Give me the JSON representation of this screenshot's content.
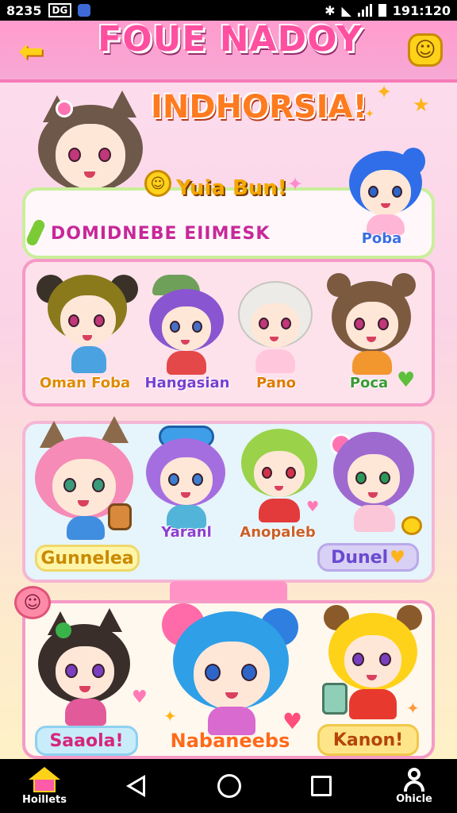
{
  "status_bar": {
    "time": "8235",
    "tag": "DG",
    "right_time": "191:120"
  },
  "header": {
    "title": "FOUE NADOY",
    "subtitle": "INDHORSIA!"
  },
  "featured": {
    "badge_label": "Yuia Bun!",
    "banner_title": "DOMIDNEBE EIIMESK",
    "side_character_name": "Poba"
  },
  "row1": [
    {
      "name": "Oman Foba"
    },
    {
      "name": "Hangasian"
    },
    {
      "name": "Pano"
    },
    {
      "name": "Poca"
    }
  ],
  "row2": {
    "names": [
      "Yaranl",
      "Anopaleb"
    ],
    "left_button": "Gunnelea",
    "right_button": "Dunel"
  },
  "row3": {
    "buttons": [
      "Saaola!",
      "Nabaneebs",
      "Kanon!"
    ]
  },
  "nav": {
    "home_label": "Hoillets",
    "profile_label": "Ohicle"
  },
  "colors": {
    "accent_pink": "#ff4fa0",
    "header_pink": "#ff9ccd",
    "gold": "#ffd21a",
    "banner_text": "#c7289a"
  },
  "icons": {
    "back": "back-arrow-icon",
    "menu": "smiley-icon",
    "home": "home-icon",
    "back_nav": "nav-back-icon",
    "home_nav": "nav-home-circle-icon",
    "recents": "nav-recents-icon",
    "profile": "profile-icon"
  }
}
